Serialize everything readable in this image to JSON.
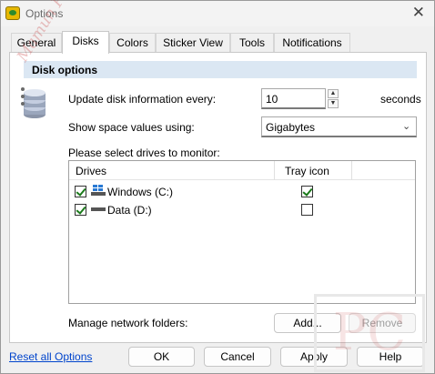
{
  "window": {
    "title": "Options",
    "close_glyph": "✕"
  },
  "tabs": [
    {
      "label": "General",
      "active": false
    },
    {
      "label": "Disks",
      "active": true
    },
    {
      "label": "Colors",
      "active": false
    },
    {
      "label": "Sticker View",
      "active": false
    },
    {
      "label": "Tools",
      "active": false
    },
    {
      "label": "Notifications",
      "active": false
    }
  ],
  "disk_options": {
    "header": "Disk options",
    "update_label": "Update disk information every:",
    "update_value": "10",
    "update_unit": "seconds",
    "space_label": "Show space values using:",
    "space_value": "Gigabytes",
    "drives_prompt": "Please select drives to monitor:"
  },
  "drives": {
    "col_drives": "Drives",
    "col_tray": "Tray icon",
    "rows": [
      {
        "name": "Windows (C:)",
        "monitored": true,
        "tray": true,
        "icon": "windows-drive-icon"
      },
      {
        "name": "Data (D:)",
        "monitored": true,
        "tray": false,
        "icon": "hard-drive-icon"
      }
    ]
  },
  "network": {
    "label": "Manage network folders:",
    "add_label": "Add...",
    "remove_label": "Remove"
  },
  "footer": {
    "reset_label": "Reset all Options",
    "ok_label": "OK",
    "cancel_label": "Cancel",
    "apply_label": "Apply",
    "help_label": "Help"
  },
  "watermarks": {
    "corner": "PC",
    "side": "Mamun PC"
  },
  "colors": {
    "header_bg": "#dbe7f3",
    "link": "#0044cc",
    "check": "#1a7a1a"
  }
}
